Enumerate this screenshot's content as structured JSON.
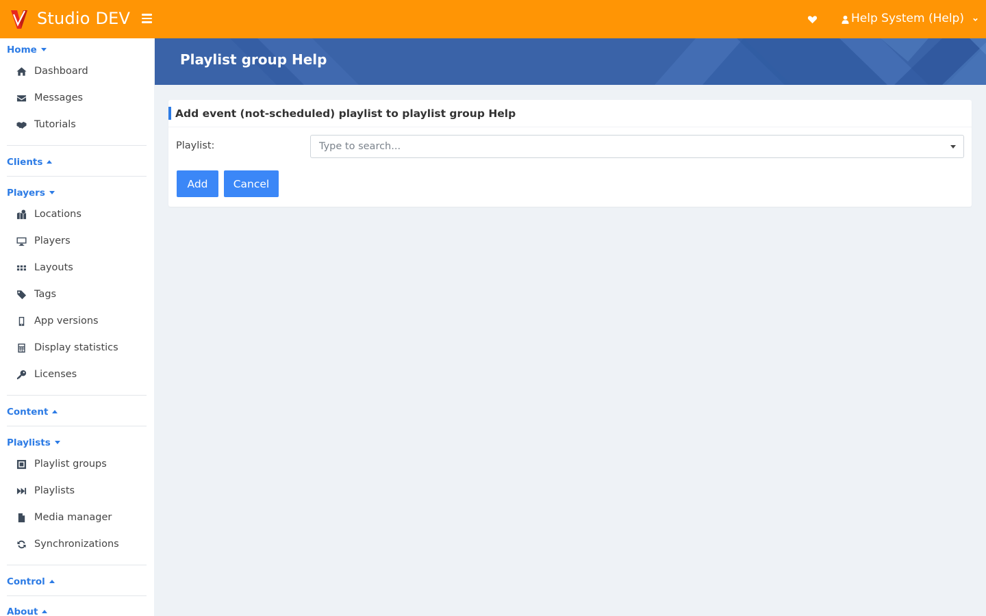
{
  "app": {
    "brand": "Studio DEV",
    "user_label": "Help System (Help)"
  },
  "sidebar": {
    "sections": {
      "home": "Home",
      "clients": "Clients",
      "players": "Players",
      "content": "Content",
      "playlists": "Playlists",
      "control": "Control",
      "about": "About"
    },
    "home_items": [
      {
        "label": "Dashboard",
        "icon": "home-icon"
      },
      {
        "label": "Messages",
        "icon": "envelope-icon"
      },
      {
        "label": "Tutorials",
        "icon": "handshake-icon"
      }
    ],
    "players_items": [
      {
        "label": "Locations",
        "icon": "map-marker-icon"
      },
      {
        "label": "Players",
        "icon": "desktop-icon"
      },
      {
        "label": "Layouts",
        "icon": "grid-icon"
      },
      {
        "label": "Tags",
        "icon": "tag-icon"
      },
      {
        "label": "App versions",
        "icon": "mobile-icon"
      },
      {
        "label": "Display statistics",
        "icon": "calculator-icon"
      },
      {
        "label": "Licenses",
        "icon": "key-icon"
      }
    ],
    "playlists_items": [
      {
        "label": "Playlist groups",
        "icon": "object-group-icon"
      },
      {
        "label": "Playlists",
        "icon": "fast-forward-icon"
      },
      {
        "label": "Media manager",
        "icon": "file-icon"
      },
      {
        "label": "Synchronizations",
        "icon": "sync-icon"
      }
    ]
  },
  "banner": {
    "title": "Playlist group Help"
  },
  "form": {
    "title": "Add event (not-scheduled) playlist to playlist group Help",
    "playlist_label": "Playlist:",
    "playlist_placeholder": "Type to search...",
    "add_label": "Add",
    "cancel_label": "Cancel"
  },
  "colors": {
    "topbar": "#ff9505",
    "accent": "#2c7be5",
    "button": "#3b87f7",
    "banner": "#3a63a8"
  }
}
